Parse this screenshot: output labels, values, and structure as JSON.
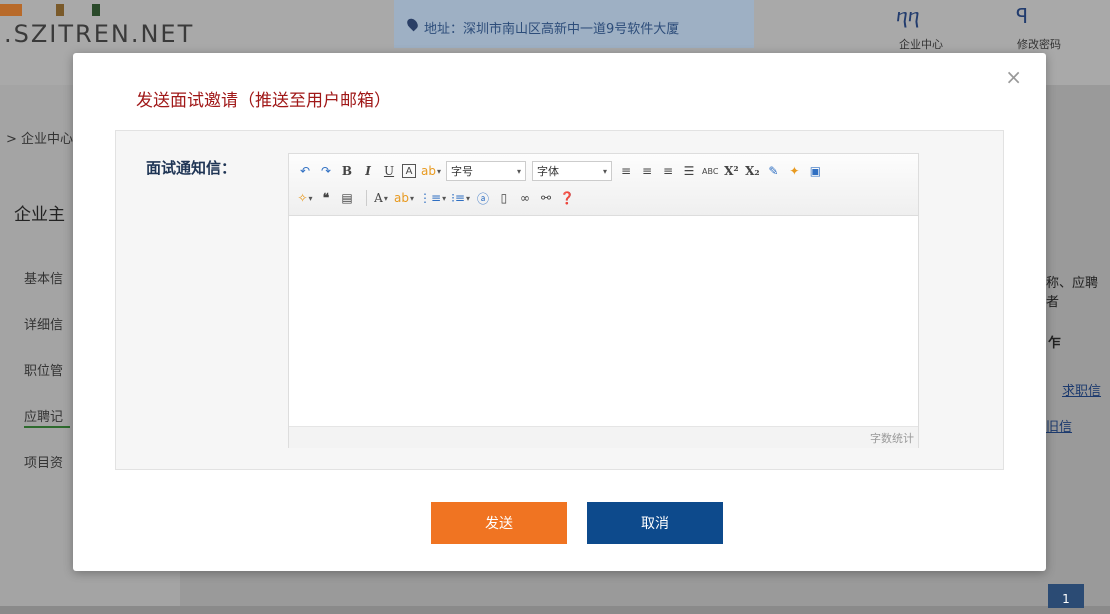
{
  "background": {
    "logo": ".SZITREN.NET",
    "address": "地址：深圳市南山区高新中一道9号软件大厦",
    "top_links": [
      {
        "icon": "person-pair-icon",
        "label": "企业中心"
      },
      {
        "icon": "key-icon",
        "label": "修改密码"
      }
    ],
    "breadcrumb": "> 企业中心",
    "sidebar_title": "企业主",
    "sidebar_items": [
      "基本信",
      "详细信",
      "职位管",
      "应聘记",
      "项目资"
    ],
    "right_search_hint": "称、应聘者",
    "right_header": "乍",
    "right_links": [
      "求职信",
      "旧信"
    ],
    "page_number": "1"
  },
  "modal": {
    "title": "发送面试邀请（推送至用户邮箱）",
    "close": "×",
    "field_label": "面试通知信：",
    "editor": {
      "font_size_select": "字号",
      "font_family_select": "字体",
      "word_count": "字数统计",
      "content": ""
    },
    "buttons": {
      "send": "发送",
      "cancel": "取消"
    }
  }
}
